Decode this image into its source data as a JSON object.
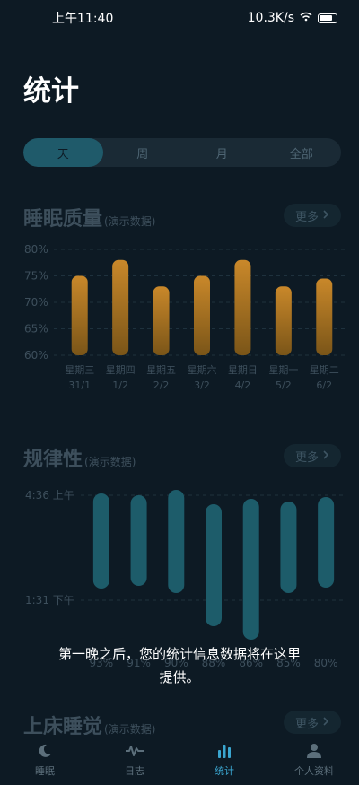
{
  "status": {
    "time": "上午11:40",
    "net": "10.3K/s"
  },
  "header": {
    "title": "统计"
  },
  "tabs": [
    {
      "label": "天",
      "active": true
    },
    {
      "label": "周",
      "active": false
    },
    {
      "label": "月",
      "active": false
    },
    {
      "label": "全部",
      "active": false
    }
  ],
  "sections": {
    "quality": {
      "title": "睡眠质量",
      "sub": "(演示数据)",
      "more": "更多"
    },
    "regularity": {
      "title": "规律性",
      "sub": "(演示数据)",
      "more": "更多"
    },
    "bedtime": {
      "title": "上床睡觉",
      "sub": "(演示数据)",
      "more": "更多"
    }
  },
  "chart_data": [
    {
      "type": "bar",
      "title": "睡眠质量",
      "categories": [
        "星期三",
        "星期四",
        "星期五",
        "星期六",
        "星期日",
        "星期一",
        "星期二"
      ],
      "dates": [
        "31/1",
        "1/2",
        "2/2",
        "3/2",
        "4/2",
        "5/2",
        "6/2"
      ],
      "values": [
        75,
        78,
        73,
        75,
        78,
        73,
        74.5
      ],
      "yticks": [
        "80%",
        "75%",
        "70%",
        "65%",
        "60%"
      ],
      "ylim": [
        60,
        80
      ],
      "color": "#c9882a"
    },
    {
      "type": "bar",
      "title": "规律性",
      "ytick_top": "4:36 上午",
      "ytick_bottom": "1:31 下午",
      "bottom_labels": [
        "93%",
        "91%",
        "90%",
        "88%",
        "86%",
        "85%",
        "80%"
      ],
      "color": "#1d5c6a"
    }
  ],
  "toast": {
    "line1": "第一晚之后，您的统计信息数据将在这里",
    "line2": "提供。"
  },
  "nav": [
    {
      "label": "睡眠",
      "icon": "moon-icon",
      "active": false
    },
    {
      "label": "日志",
      "icon": "pulse-icon",
      "active": false
    },
    {
      "label": "统计",
      "icon": "bar-chart-icon",
      "active": true
    },
    {
      "label": "个人资料",
      "icon": "person-icon",
      "active": false
    }
  ]
}
